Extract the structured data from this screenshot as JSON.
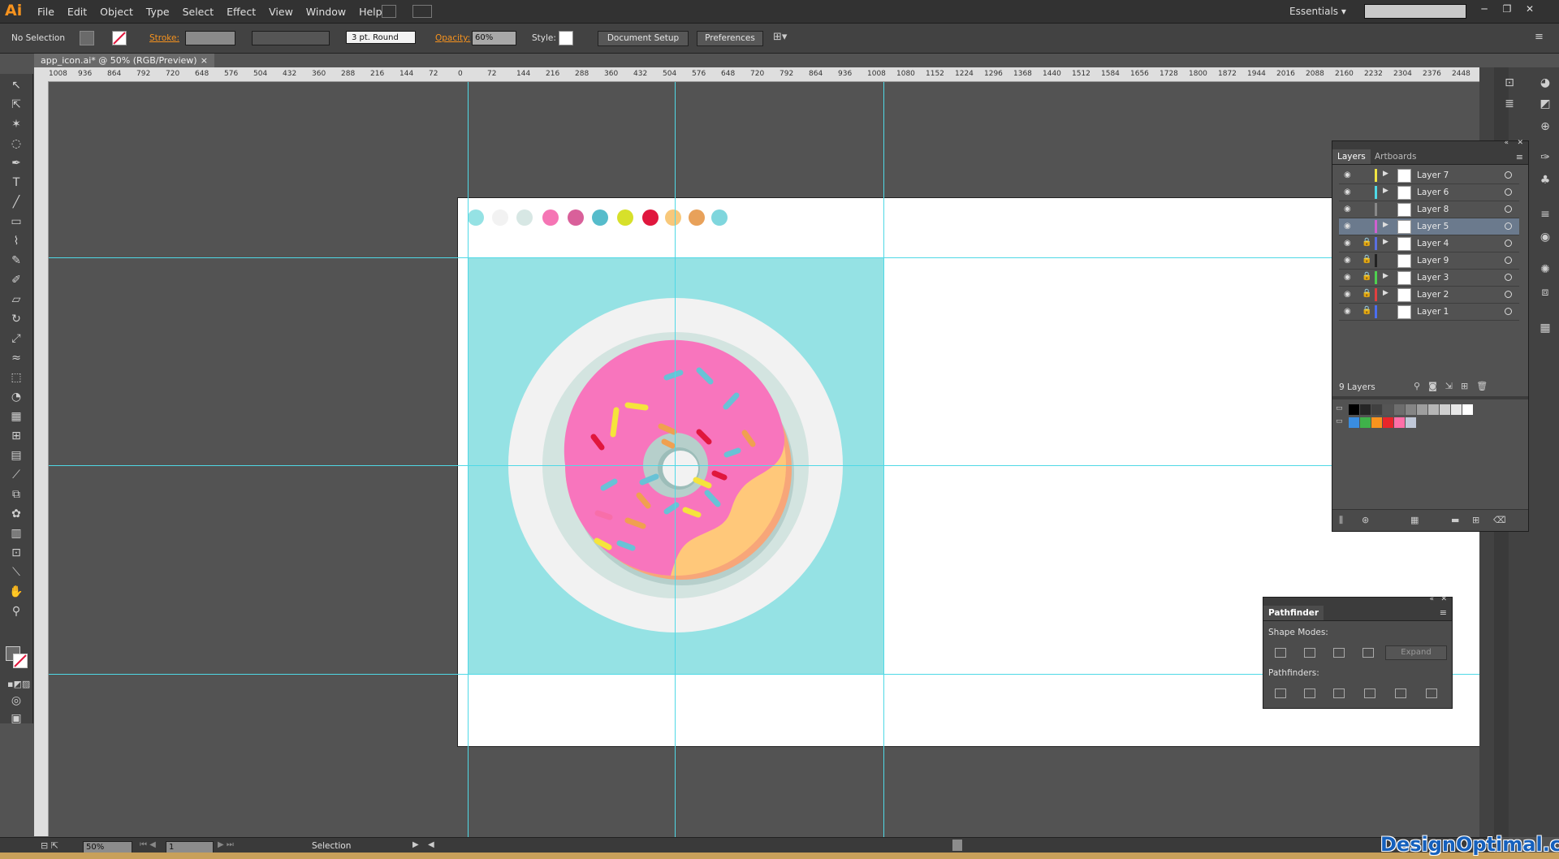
{
  "app": {
    "logo": "Ai",
    "menus": [
      "File",
      "Edit",
      "Object",
      "Type",
      "Select",
      "Effect",
      "View",
      "Window",
      "Help"
    ],
    "workspace": "Essentials"
  },
  "control": {
    "selection": "No Selection",
    "stroke_label": "Stroke:",
    "brush": "3 pt. Round",
    "opacity_label": "Opacity:",
    "opacity_value": "60%",
    "style_label": "Style:",
    "doc_setup": "Document Setup",
    "preferences": "Preferences"
  },
  "document": {
    "tab_title": "app_icon.ai* @ 50% (RGB/Preview)",
    "close": "×"
  },
  "ruler": {
    "h_ticks": [
      "1008",
      "936",
      "864",
      "792",
      "720",
      "648",
      "576",
      "504",
      "432",
      "360",
      "288",
      "216",
      "144",
      "72",
      "0",
      "72",
      "144",
      "216",
      "288",
      "360",
      "432",
      "504",
      "576",
      "648",
      "720",
      "792",
      "864",
      "936",
      "1008",
      "1080",
      "1152",
      "1224",
      "1296",
      "1368",
      "1440",
      "1512",
      "1584",
      "1656",
      "1728",
      "1800",
      "1872",
      "1944",
      "2016",
      "2088",
      "2160",
      "2232",
      "2304",
      "2376",
      "2448"
    ]
  },
  "palette_dots": [
    "#95e2e4",
    "#f2f2f2",
    "#d7e7e4",
    "#f575b4",
    "#d9609a",
    "#56bccb",
    "#d7e02a",
    "#e0173d",
    "#f8c87a",
    "#e8a15a",
    "#7fd6dd"
  ],
  "sprinkle_colors": {
    "yellow": "#f5e43c",
    "blue": "#68c2d6",
    "red": "#e0173d",
    "orange": "#f0a050",
    "pink": "#f86ea9"
  },
  "layers_panel": {
    "tabs": [
      "Layers",
      "Artboards"
    ],
    "rows": [
      {
        "name": "Layer 7",
        "color": "#f0e442",
        "locked": false,
        "expand": true
      },
      {
        "name": "Layer 6",
        "color": "#4fd9e6",
        "locked": false,
        "expand": true
      },
      {
        "name": "Layer 8",
        "color": "#888888",
        "locked": false,
        "expand": false
      },
      {
        "name": "Layer 5",
        "color": "#d05fd0",
        "locked": false,
        "expand": true
      },
      {
        "name": "Layer 4",
        "color": "#5a6fe0",
        "locked": true,
        "expand": true
      },
      {
        "name": "Layer 9",
        "color": "#222222",
        "locked": true,
        "expand": false
      },
      {
        "name": "Layer 3",
        "color": "#4fd050",
        "locked": true,
        "expand": true
      },
      {
        "name": "Layer 2",
        "color": "#e04040",
        "locked": true,
        "expand": true
      },
      {
        "name": "Layer 1",
        "color": "#4a6ef0",
        "locked": true,
        "expand": false
      }
    ],
    "count": "9 Layers"
  },
  "swatches": {
    "row1": [
      "#000000",
      "#262626",
      "#404040",
      "#555555",
      "#6d6d6d",
      "#858585",
      "#9e9e9e",
      "#b6b6b6",
      "#cfcfcf",
      "#e7e7e7",
      "#ffffff"
    ],
    "row2": [
      "#3a8de0",
      "#3fb24a",
      "#f7931e",
      "#e8252a",
      "#ff6fa8",
      "#c0c8d8"
    ]
  },
  "pathfinder": {
    "title": "Pathfinder",
    "shape_modes": "Shape Modes:",
    "expand": "Expand",
    "pathfinders": "Pathfinders:"
  },
  "status": {
    "zoom": "50%",
    "page": "1",
    "tool": "Selection"
  },
  "watermark": "DesignOptimal.com"
}
